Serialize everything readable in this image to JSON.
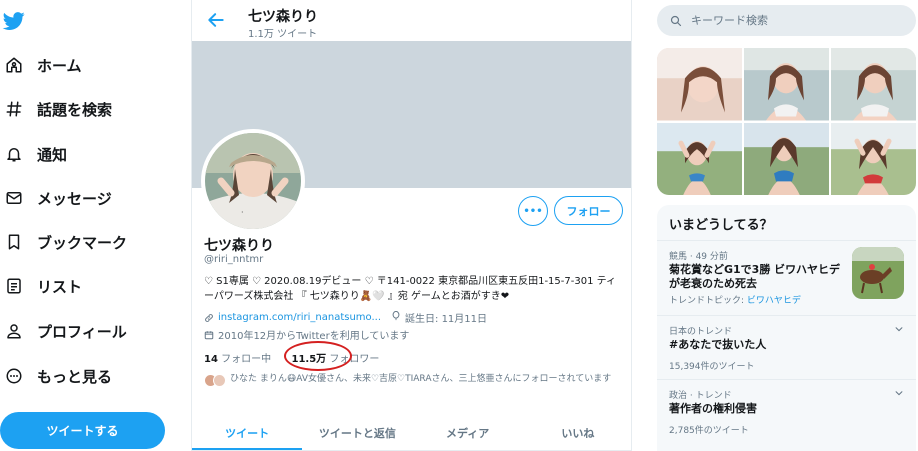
{
  "nav": {
    "items": [
      {
        "label": "ホーム",
        "icon": "home-icon"
      },
      {
        "label": "話題を検索",
        "icon": "hashtag-icon"
      },
      {
        "label": "通知",
        "icon": "bell-icon"
      },
      {
        "label": "メッセージ",
        "icon": "envelope-icon"
      },
      {
        "label": "ブックマーク",
        "icon": "bookmark-icon"
      },
      {
        "label": "リスト",
        "icon": "list-icon"
      },
      {
        "label": "プロフィール",
        "icon": "person-icon"
      },
      {
        "label": "もっと見る",
        "icon": "more-circle-icon"
      }
    ],
    "tweet_button": "ツイートする"
  },
  "header": {
    "name": "七ツ森りり",
    "tweet_count": "1.1万 ツイート"
  },
  "profile": {
    "name": "七ツ森りり",
    "handle": "@riri_nntmr",
    "bio": "♡ S1専属 ♡ 2020.08.19デビュー ♡ 〒141-0022 東京都品川区東五反田1-15-7-301 ティーパワーズ株式会社 『 七ツ森りり🧸🤍 』宛 ゲームとお酒がすき❤",
    "link": "instagram.com/riri_nanatsumo...",
    "birthday": "誕生日: 11月11日",
    "joined": "2010年12月からTwitterを利用しています",
    "following_count": "14",
    "following_label": "フォロー中",
    "followers_count": "11.5万",
    "followers_label": "フォロワー",
    "followed_by": "ひなた まりん😷AV女優さん、未来♡吉原♡TIARAさん、三上悠亜さんにフォローされています",
    "more_button": "•••",
    "follow_button": "フォロー"
  },
  "tabs": [
    "ツイート",
    "ツイートと返信",
    "メディア",
    "いいね"
  ],
  "search": {
    "placeholder": "キーワード検索"
  },
  "trends": {
    "title": "いまどうしてる？",
    "items": [
      {
        "meta": "競馬 · 49 分前",
        "main": "菊花賞などG1で3勝 ビワハヤヒデが老衰のため死去",
        "sub_prefix": "トレンドトピック: ",
        "sub_link": "ビワハヤヒデ"
      },
      {
        "meta": "日本のトレンド",
        "main": "#あなたで抜いた人",
        "sub": "15,394件のツイート"
      },
      {
        "meta": "政治 · トレンド",
        "main": "著作者の権利侵害",
        "sub": "2,785件のツイート"
      }
    ]
  },
  "colors": {
    "accent": "#1da1f2",
    "annotation": "#d42020",
    "banner": "#ccd6dd"
  }
}
